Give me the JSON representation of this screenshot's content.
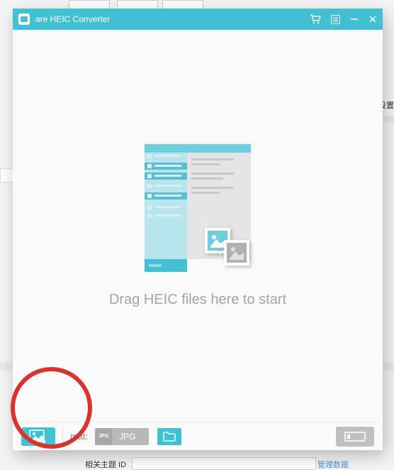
{
  "app": {
    "title": "are HEIC Converter"
  },
  "dropzone": {
    "instruction": "Drag HEIC files here to start"
  },
  "bottombar": {
    "format_label": "mat:",
    "format_badge": "JPG",
    "format_value": "JPG"
  },
  "bg": {
    "right_text": "设置",
    "bottom_label": "相关主题 ID",
    "bottom_link": "管理数据"
  },
  "icons": {
    "cart": "cart-icon",
    "list": "list-icon",
    "minimize": "minimize-icon",
    "close": "close-icon",
    "add_image": "add-image-icon",
    "folder": "folder-icon",
    "convert": "convert-icon"
  }
}
